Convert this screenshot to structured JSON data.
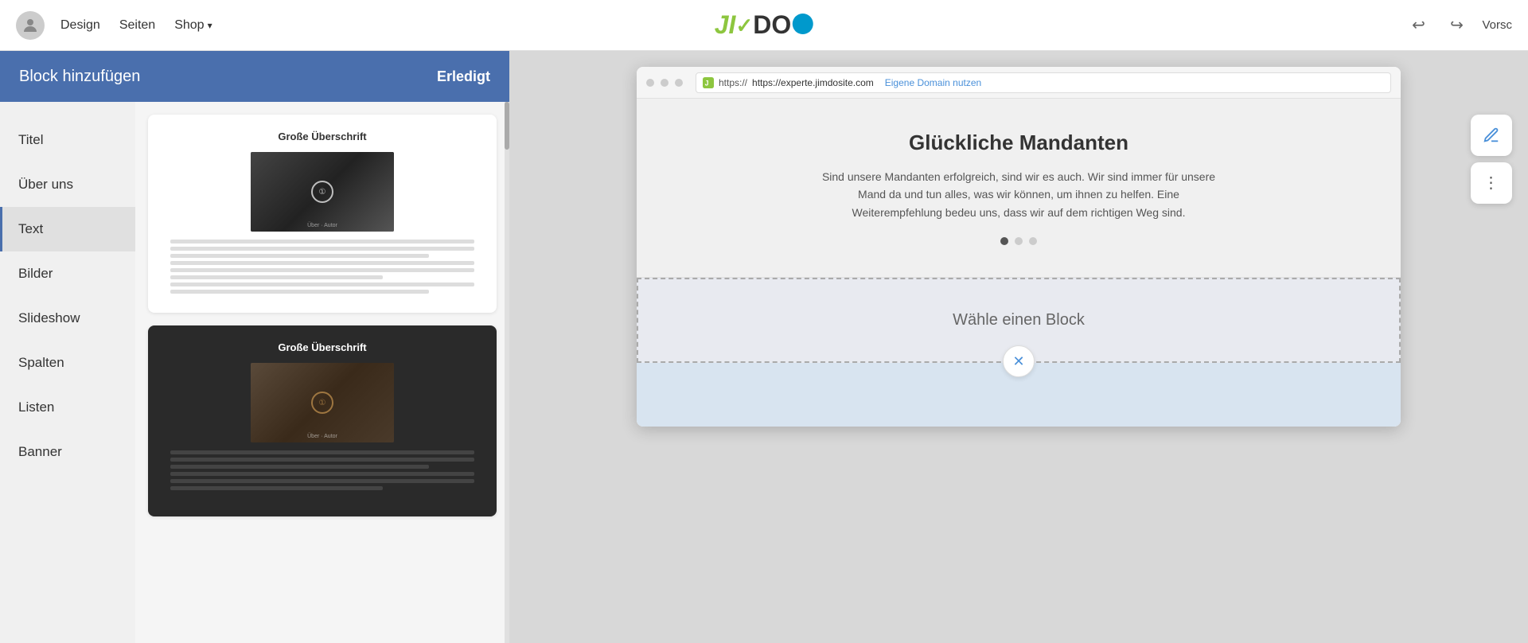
{
  "topNav": {
    "links": [
      {
        "label": "Design",
        "id": "design"
      },
      {
        "label": "Seiten",
        "id": "seiten"
      },
      {
        "label": "Shop",
        "id": "shop",
        "hasArrow": true
      }
    ],
    "undo_label": "↩",
    "redo_label": "↪",
    "preview_label": "Vorsc"
  },
  "logo": {
    "text": "JIMDO"
  },
  "panel": {
    "header_title": "Block hinzufügen",
    "done_label": "Erledigt"
  },
  "sidebarItems": [
    {
      "label": "Titel",
      "id": "titel",
      "active": false
    },
    {
      "label": "Über uns",
      "id": "ueber-uns",
      "active": false
    },
    {
      "label": "Text",
      "id": "text",
      "active": true
    },
    {
      "label": "Bilder",
      "id": "bilder",
      "active": false
    },
    {
      "label": "Slideshow",
      "id": "slideshow",
      "active": false
    },
    {
      "label": "Spalten",
      "id": "spalten",
      "active": false
    },
    {
      "label": "Listen",
      "id": "listen",
      "active": false
    },
    {
      "label": "Banner",
      "id": "banner",
      "active": false
    }
  ],
  "blockCards": [
    {
      "id": "card-1",
      "theme": "light",
      "heading": "Große Überschrift",
      "hasImage": true
    },
    {
      "id": "card-2",
      "theme": "dark",
      "heading": "Große Überschrift",
      "hasImage": true
    }
  ],
  "browser": {
    "url": "https://experte.jimdosite.com",
    "domain_link": "Eigene Domain nutzen",
    "slideshow": {
      "title": "Glückliche Mandanten",
      "text": "Sind unsere Mandanten erfolgreich, sind wir es auch. Wir sind immer für unsere Mand da und tun alles, was wir können, um ihnen zu helfen. Eine Weiterempfehlung bedeu uns, dass wir auf dem richtigen Weg sind.",
      "dots": [
        true,
        false,
        false
      ]
    },
    "choose_block_label": "Wähle einen Block"
  }
}
